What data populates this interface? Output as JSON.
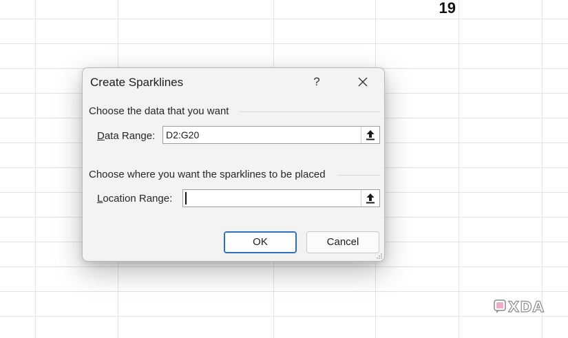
{
  "spreadsheet": {
    "visible_cell_value": "19"
  },
  "dialog": {
    "title": "Create Sparklines",
    "help_label": "?",
    "data_group": {
      "heading": "Choose the data that you want",
      "label_accel": "D",
      "label_rest": "ata Range:",
      "value": "D2:G20"
    },
    "location_group": {
      "heading": "Choose where you want the sparklines to be placed",
      "label_accel": "L",
      "label_rest": "ocation Range:",
      "value": ""
    },
    "ok_label": "OK",
    "cancel_label": "Cancel"
  },
  "watermark": {
    "text": "XDA"
  },
  "colors": {
    "ok_border": "#2a6fbd",
    "dialog_bg": "#f3f3f3",
    "gridline": "#e3e3e3"
  },
  "icons": {
    "close": "close-icon",
    "collapse": "upload-arrow-icon",
    "grip": "resize-grip-icon"
  }
}
